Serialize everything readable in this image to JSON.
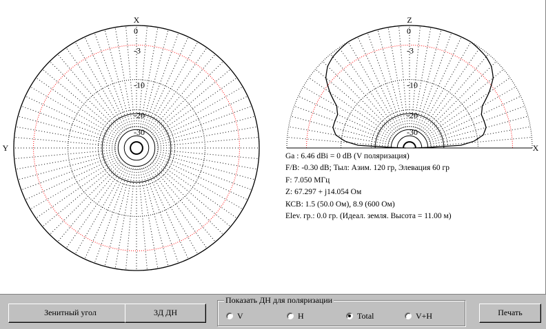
{
  "chart_data": [
    {
      "type": "polar",
      "view": "azimuth",
      "axis_top_label": "X",
      "axis_left_label": "Y",
      "ring_labels": [
        "0",
        "-3",
        "-10",
        "-20",
        "-30"
      ],
      "ring_levels_db": [
        0,
        -3,
        -10,
        -20,
        -30
      ],
      "spoke_step_deg": 5,
      "series": [
        {
          "polarization": "Total",
          "gain_db": [
            [
              0,
              0
            ],
            [
              15,
              0
            ],
            [
              30,
              0
            ],
            [
              45,
              0
            ],
            [
              60,
              0
            ],
            [
              75,
              0
            ],
            [
              90,
              0
            ],
            [
              105,
              0
            ],
            [
              120,
              0
            ],
            [
              135,
              0
            ],
            [
              150,
              0
            ],
            [
              165,
              0
            ],
            [
              180,
              0
            ],
            [
              195,
              0
            ],
            [
              210,
              0
            ],
            [
              225,
              0
            ],
            [
              240,
              0
            ],
            [
              255,
              0
            ],
            [
              270,
              0
            ],
            [
              285,
              0
            ],
            [
              300,
              0
            ],
            [
              315,
              0
            ],
            [
              330,
              0
            ],
            [
              345,
              0
            ],
            [
              360,
              0
            ]
          ]
        }
      ]
    },
    {
      "type": "polar",
      "view": "elevation",
      "axis_top_label": "Z",
      "axis_right_label": "X",
      "ring_labels": [
        "0",
        "-3",
        "-10",
        "-20",
        "-30"
      ],
      "ring_levels_db": [
        0,
        -3,
        -10,
        -20,
        -30
      ],
      "spoke_step_deg": 5,
      "series": [
        {
          "polarization": "Total",
          "gain_db": [
            [
              0,
              -60
            ],
            [
              3,
              -15
            ],
            [
              6,
              -11
            ],
            [
              10,
              -8.5
            ],
            [
              15,
              -7.5
            ],
            [
              20,
              -7.5
            ],
            [
              25,
              -7.5
            ],
            [
              30,
              -6.5
            ],
            [
              35,
              -4
            ],
            [
              40,
              -2
            ],
            [
              45,
              -1
            ],
            [
              50,
              -0.5
            ],
            [
              60,
              0
            ],
            [
              70,
              0
            ],
            [
              80,
              0
            ],
            [
              90,
              0
            ],
            [
              100,
              0
            ],
            [
              110,
              0
            ],
            [
              120,
              0
            ],
            [
              130,
              -0.5
            ],
            [
              135,
              -1
            ],
            [
              140,
              -2
            ],
            [
              145,
              -4
            ],
            [
              150,
              -6.5
            ],
            [
              155,
              -7.5
            ],
            [
              160,
              -7.5
            ],
            [
              165,
              -7.5
            ],
            [
              170,
              -8.5
            ],
            [
              174,
              -11
            ],
            [
              177,
              -15
            ],
            [
              180,
              -60
            ]
          ]
        }
      ]
    }
  ],
  "info": {
    "line1": "Ga : 6.46 dBi = 0 dB  (V поляризация)",
    "line2": "F/B: -0.30 dB; Тыл: Азим. 120 гр, Элевация 60 гр",
    "line3": "F: 7.050 МГц",
    "line4": "Z: 67.297 + j14.054 Ом",
    "line5": "КСВ: 1.5 (50.0 Ом), 8.9 (600 Ом)",
    "line6": "Elev. гр.: 0.0 гр. (Идеал. земля. Высота = 11.00 м)"
  },
  "toolbar": {
    "zenith_button": "Зенитный угол",
    "pattern3d_button": "3Д  ДН",
    "print_button": "Печать",
    "polarization_group_label": "Показать ДН для поляризации",
    "polarization_options": [
      "V",
      "H",
      "Total",
      "V+H"
    ],
    "selected_polarization": "Total"
  },
  "colors": {
    "minus3_ring": "#ff0000",
    "grid": "#000000",
    "trace": "#000000",
    "background": "#ffffff",
    "panel": "#c0c0c0"
  }
}
